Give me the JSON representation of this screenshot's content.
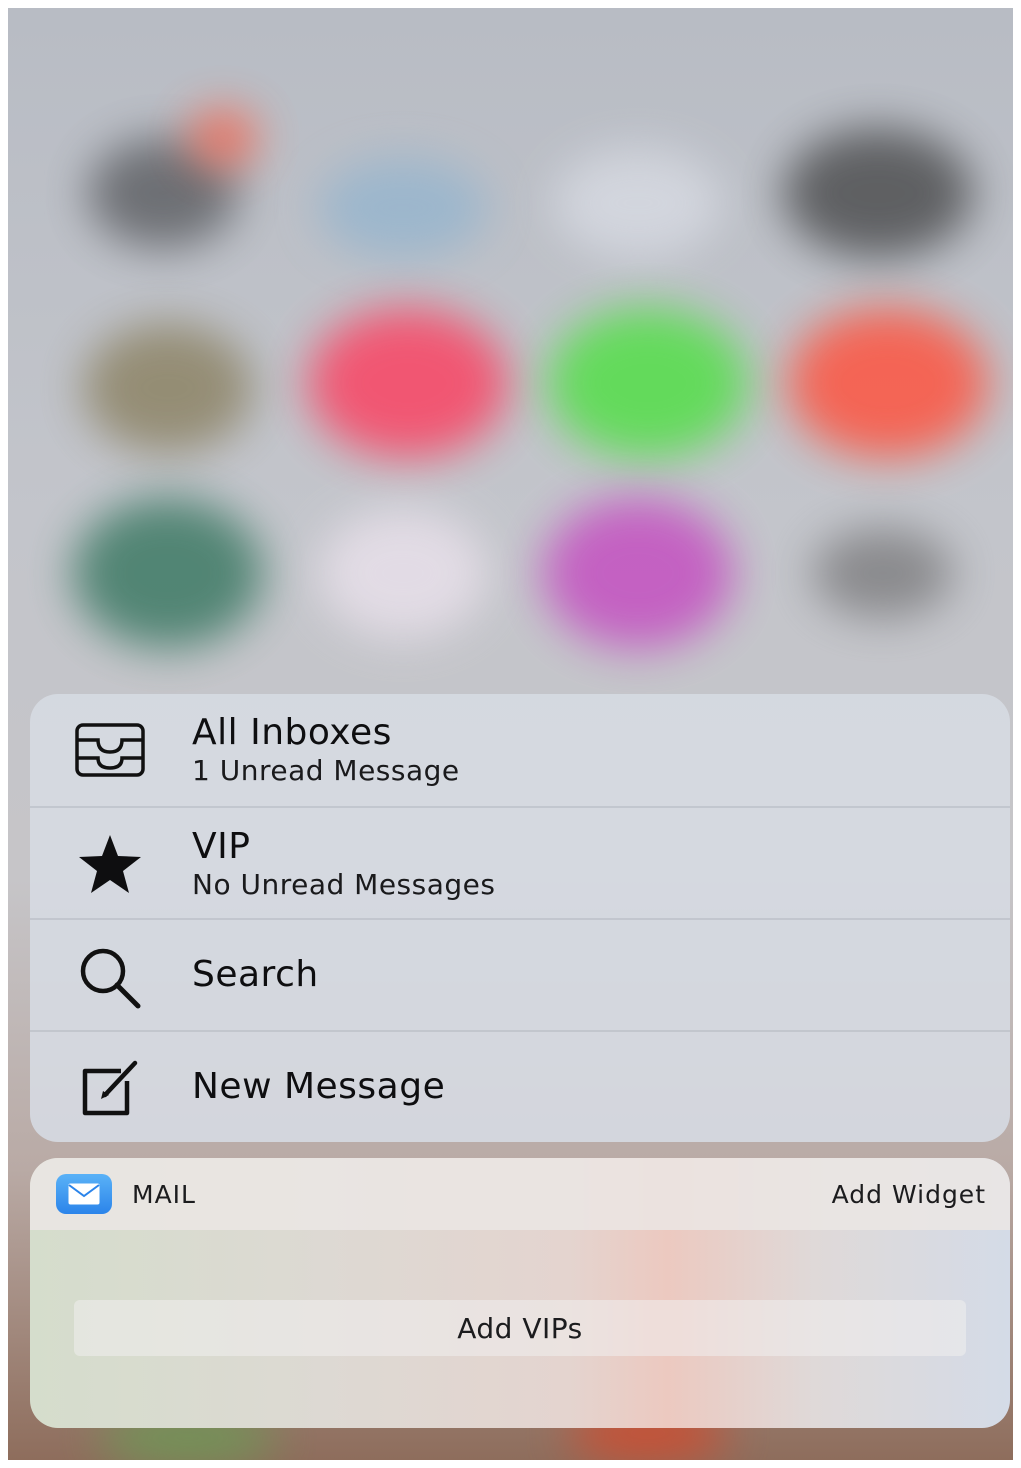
{
  "quick_actions": [
    {
      "icon": "inbox-tray-icon",
      "title": "All Inboxes",
      "subtitle": "1 Unread Message"
    },
    {
      "icon": "star-icon",
      "title": "VIP",
      "subtitle": "No Unread Messages"
    },
    {
      "icon": "search-icon",
      "title": "Search"
    },
    {
      "icon": "compose-icon",
      "title": "New Message"
    }
  ],
  "widget": {
    "app_icon": "mail-envelope-icon",
    "app_name": "MAIL",
    "add_widget_label": "Add Widget",
    "add_vips_label": "Add VIPs"
  },
  "colors": {
    "menu_background": "#d6dae2",
    "text": "#0e0e10",
    "mail_icon_blue": "#2b84ea"
  }
}
